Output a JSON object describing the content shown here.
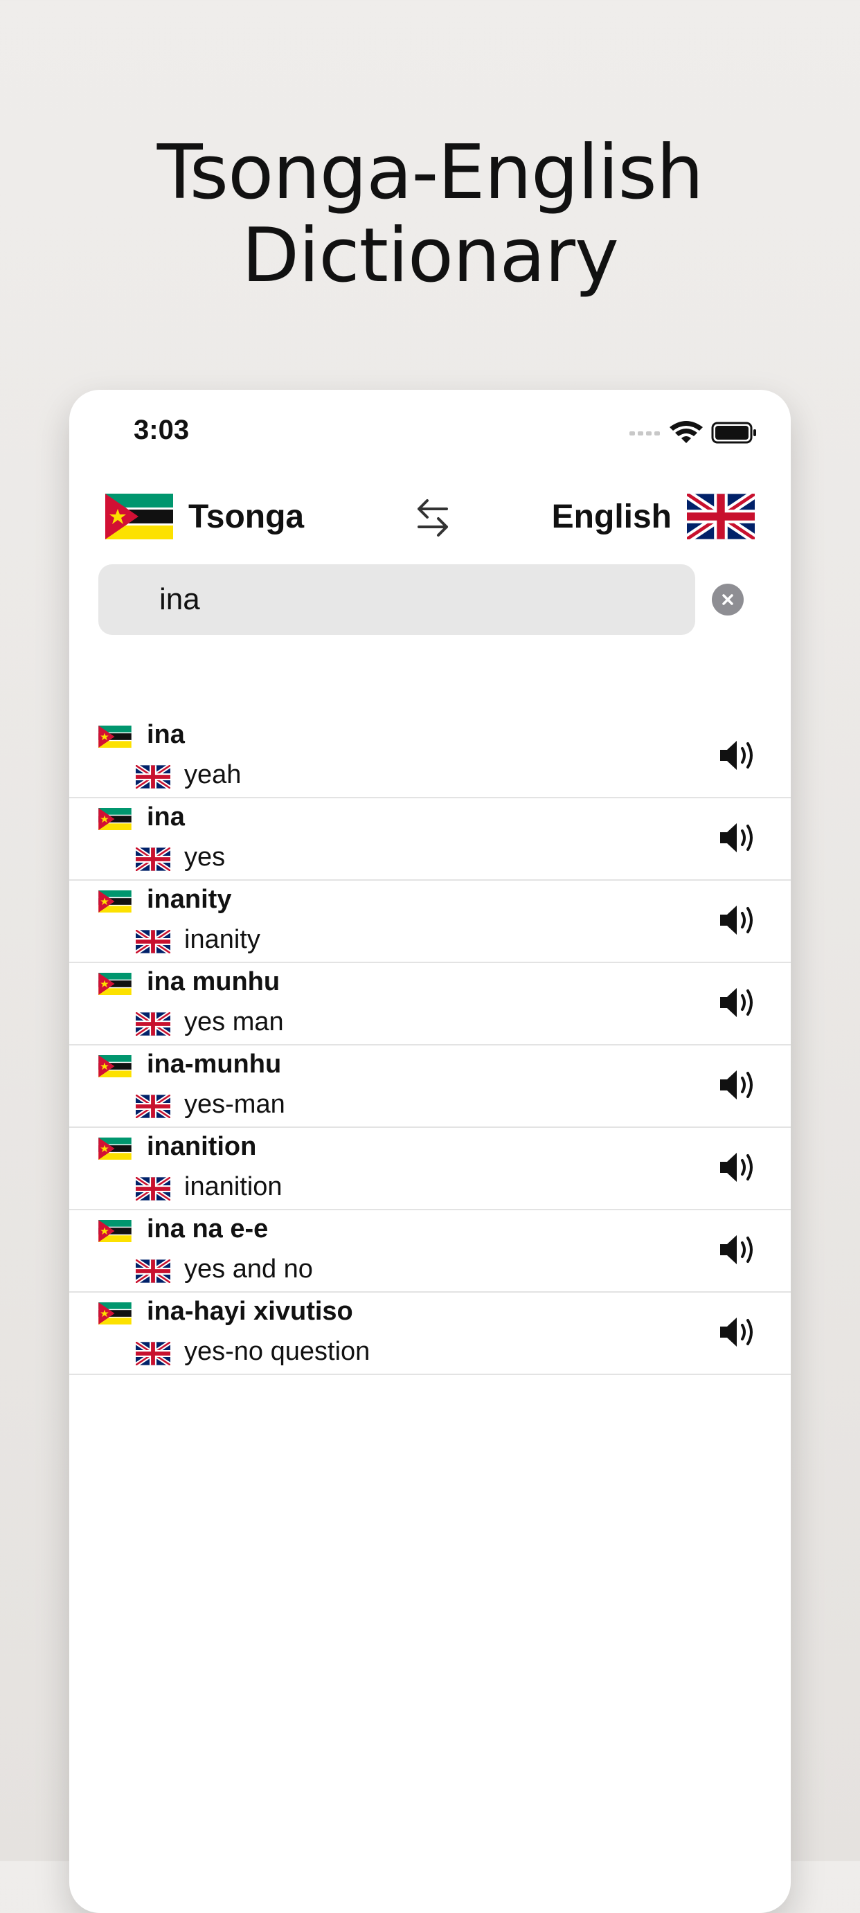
{
  "headline": "Tsonga-English Dictionary",
  "status": {
    "time": "3:03"
  },
  "languages": {
    "from": {
      "name": "Tsonga",
      "flag": "mozambique-flag"
    },
    "to": {
      "name": "English",
      "flag": "uk-flag"
    },
    "swap_icon": "swap-arrows-icon"
  },
  "search": {
    "value": "ina",
    "clear_icon": "clear-icon"
  },
  "results": [
    {
      "term": "ina",
      "translation": "yeah"
    },
    {
      "term": "ina",
      "translation": "yes"
    },
    {
      "term": "inanity",
      "translation": "inanity"
    },
    {
      "term": "ina munhu",
      "translation": "yes man"
    },
    {
      "term": "ina-munhu",
      "translation": "yes-man"
    },
    {
      "term": "inanition",
      "translation": "inanition"
    },
    {
      "term": "ina na e-e",
      "translation": "yes and no"
    },
    {
      "term": "ina-hayi xivutiso",
      "translation": "yes-no question"
    }
  ],
  "colors": {
    "accent": "#111111",
    "search_bg": "#e7e7e7",
    "clear_bg": "#8e8e93"
  }
}
